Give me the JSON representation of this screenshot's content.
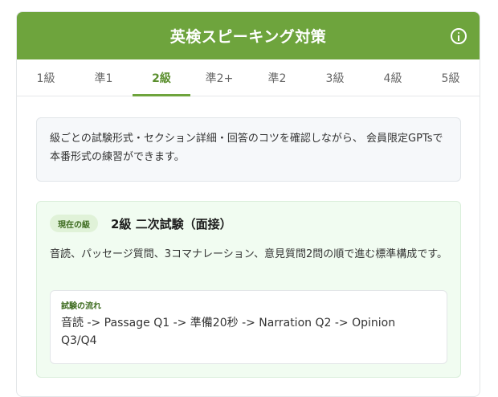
{
  "header": {
    "title": "英検スピーキング対策",
    "info_icon": "info-circle-icon",
    "bg_color": "#6ea43d"
  },
  "tabs": [
    {
      "label": "1級",
      "active": false
    },
    {
      "label": "準1",
      "active": false
    },
    {
      "label": "2級",
      "active": true
    },
    {
      "label": "準2+",
      "active": false
    },
    {
      "label": "準2",
      "active": false
    },
    {
      "label": "3級",
      "active": false
    },
    {
      "label": "4級",
      "active": false
    },
    {
      "label": "5級",
      "active": false
    }
  ],
  "intro": {
    "text": "級ごとの試験形式・セクション詳細・回答のコツを確認しながら、 会員限定GPTsで本番形式の練習ができます。"
  },
  "current": {
    "badge": "現在の級",
    "title": "2級 二次試験（面接）",
    "description": "音読、パッセージ質問、3コマナレーション、意見質問2問の順で進む標準構成です。",
    "flow_label": "試験の流れ",
    "flow_text": "音読 -> Passage Q1 -> 準備20秒 -> Narration Q2 -> Opinion Q3/Q4"
  }
}
